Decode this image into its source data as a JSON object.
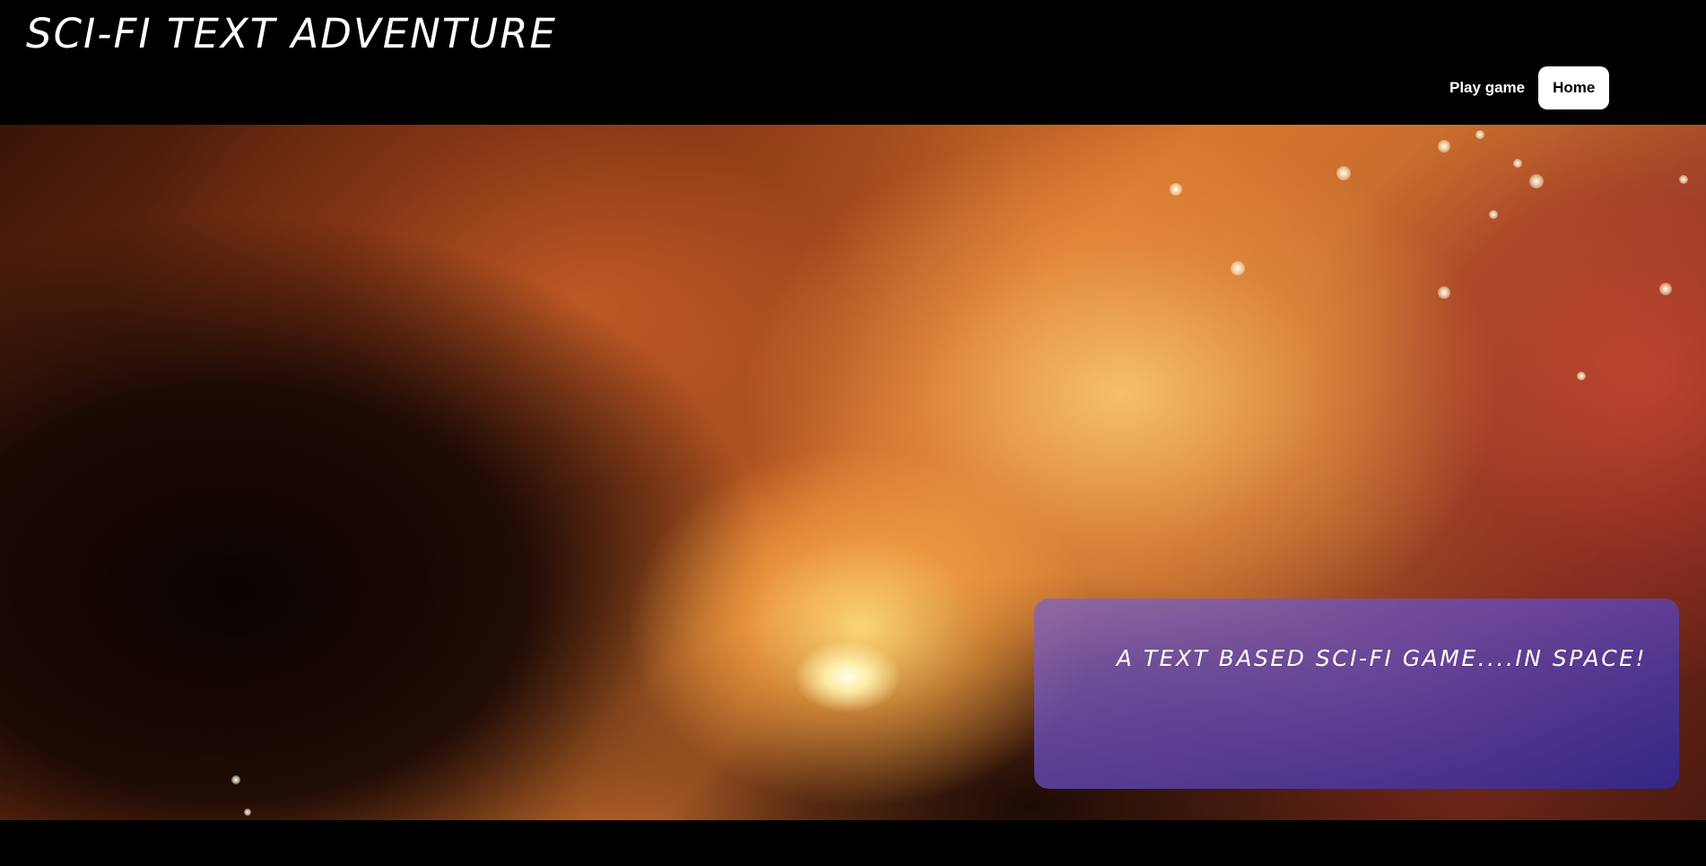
{
  "header": {
    "site_title": "SCI-FI TEXT ADVENTURE"
  },
  "nav": {
    "items": [
      {
        "label": "Play game",
        "active": false
      },
      {
        "label": "Home",
        "active": true
      }
    ]
  },
  "hero": {
    "tagline": "A TEXT BASED SCI-FI GAME....IN SPACE!"
  },
  "colors": {
    "header_background": "#000000",
    "text": "#ffffff",
    "active_nav_background": "#ffffff",
    "tagline_panel": "#5f46b4"
  }
}
